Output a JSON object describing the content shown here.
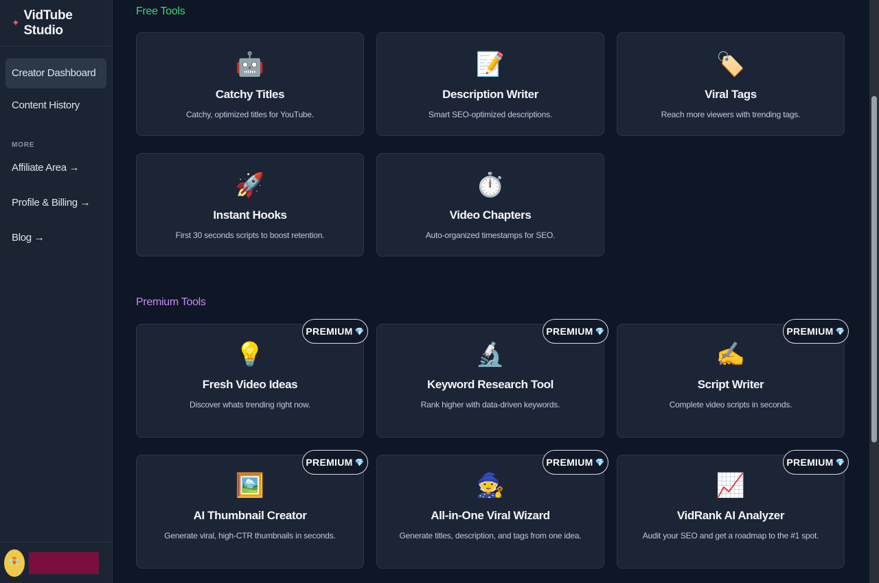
{
  "sidebar": {
    "brand": "VidTube Studio",
    "nav": [
      {
        "label": "Creator Dashboard",
        "active": true
      },
      {
        "label": "Content History",
        "active": false
      }
    ],
    "more_label": "MORE",
    "more_items": [
      {
        "label": "Affiliate Area →"
      },
      {
        "label": "Profile & Billing →"
      },
      {
        "label": "Blog →"
      }
    ]
  },
  "free_tools": {
    "title": "Free Tools",
    "cards": [
      {
        "icon": "robot-icon",
        "glyph": "🤖",
        "title": "Catchy Titles",
        "desc": "Catchy, optimized titles for YouTube."
      },
      {
        "icon": "memo-icon",
        "glyph": "📝",
        "title": "Description Writer",
        "desc": "Smart SEO-optimized descriptions."
      },
      {
        "icon": "tag-icon",
        "glyph": "🏷️",
        "title": "Viral Tags",
        "desc": "Reach more viewers with trending tags."
      },
      {
        "icon": "rocket-icon",
        "glyph": "🚀",
        "title": "Instant Hooks",
        "desc": "First 30 seconds scripts to boost retention."
      },
      {
        "icon": "stopwatch-icon",
        "glyph": "⏱️",
        "title": "Video Chapters",
        "desc": "Auto-organized timestamps for SEO."
      }
    ]
  },
  "premium_tools": {
    "title": "Premium Tools",
    "badge": "PREMIUM",
    "cards": [
      {
        "icon": "lightbulb-icon",
        "glyph": "💡",
        "title": "Fresh Video Ideas",
        "desc": "Discover whats trending right now."
      },
      {
        "icon": "microscope-icon",
        "glyph": "🔬",
        "title": "Keyword Research Tool",
        "desc": "Rank higher with data-driven keywords."
      },
      {
        "icon": "writing-hand-icon",
        "glyph": "✍️",
        "title": "Script Writer",
        "desc": "Complete video scripts in seconds."
      },
      {
        "icon": "framed-picture-icon",
        "glyph": "🖼️",
        "title": "AI Thumbnail Creator",
        "desc": "Generate viral, high-CTR thumbnails in seconds."
      },
      {
        "icon": "wizard-icon",
        "glyph": "🧙",
        "title": "All-in-One Viral Wizard",
        "desc": "Generate titles, description, and tags from one idea."
      },
      {
        "icon": "chart-increasing-icon",
        "glyph": "📈",
        "title": "VidRank AI Analyzer",
        "desc": "Audit your SEO and get a roadmap to the #1 spot."
      }
    ]
  },
  "colors": {
    "free_accent": "#3fd47a",
    "premium_accent": "#c58cf5",
    "brand_spark": "#f0566a"
  }
}
